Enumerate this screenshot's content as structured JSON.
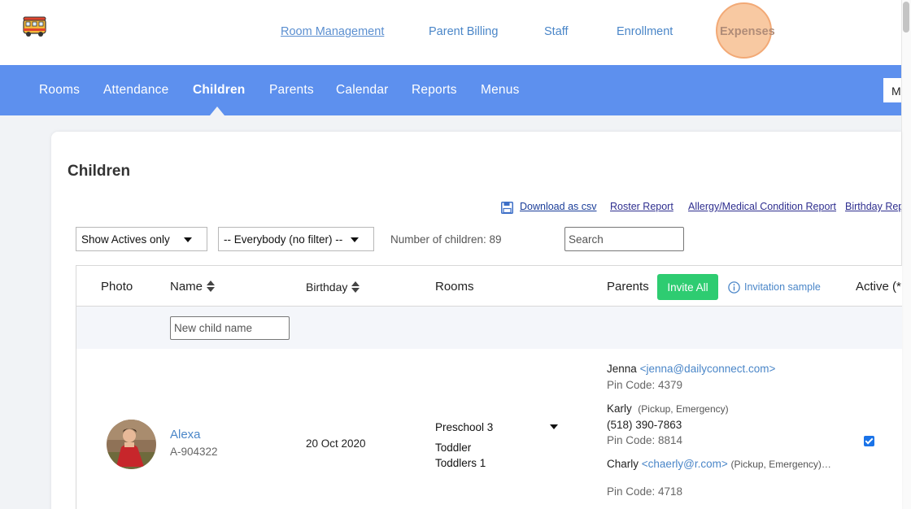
{
  "top_nav": {
    "room_management": "Room Management",
    "parent_billing": "Parent Billing",
    "staff": "Staff",
    "enrollment": "Enrollment",
    "expenses": "Expenses"
  },
  "main_nav": {
    "items": [
      "Rooms",
      "Attendance",
      "Children",
      "Parents",
      "Calendar",
      "Reports",
      "Menus"
    ],
    "active": "Children",
    "right_box_text": "M"
  },
  "page": {
    "title": "Children"
  },
  "reports": {
    "download_csv": "Download as csv",
    "roster": "Roster Report",
    "allergy": "Allergy/Medical Condition Report",
    "birthday": "Birthday Rep"
  },
  "filters": {
    "status_select": "Show Actives only",
    "group_select": "-- Everybody (no filter) --",
    "count_text": "Number of children: 89",
    "search_placeholder": "Search"
  },
  "table": {
    "headers": {
      "photo": "Photo",
      "name": "Name",
      "birthday": "Birthday",
      "rooms": "Rooms",
      "parents": "Parents",
      "active": "Active (*"
    },
    "invite_all": "Invite All",
    "invitation_sample": "Invitation sample",
    "new_child_placeholder": "New child name",
    "rows": [
      {
        "name": "Alexa",
        "id": "A-904322",
        "birthday": "20 Oct 2020",
        "room": "Preschool 3",
        "other_rooms": [
          "Toddler",
          "Toddlers 1"
        ],
        "active": true,
        "parents": [
          {
            "name": "Jenna",
            "email": "<jenna@dailyconnect.com>",
            "pin": "Pin Code: 4379"
          },
          {
            "name": "Karly",
            "role": "(Pickup, Emergency)",
            "phone": "(518) 390-7863",
            "pin": "Pin Code: 8814"
          },
          {
            "name": "Charly",
            "email": "<chaerly@r.com>",
            "role": "(Pickup, Emergency)…",
            "pin": "Pin Code: 4718"
          }
        ]
      }
    ]
  },
  "colors": {
    "nav_blue": "#5d90ee",
    "link_blue": "#4a86c8",
    "invite_green": "#2ecc71",
    "highlight_orange": "#f8c79e"
  }
}
